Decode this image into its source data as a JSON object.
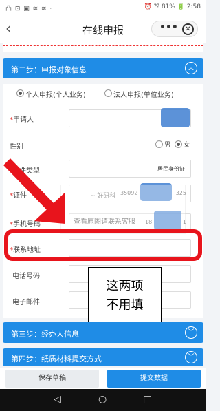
{
  "status": {
    "left": "凸 ⊡ ▣ ≋ ≋ ·",
    "right": "⏰ ⁇ 81% 🔋 2:58"
  },
  "nav": {
    "back": "‹",
    "title": "在线申报",
    "more": "•••",
    "close": "✕"
  },
  "section2": {
    "title": "第二步：申报对象信息",
    "chevron": "︿"
  },
  "form": {
    "applicant_type_personal": "个人申报(个人业务)",
    "applicant_type_legal": "法人申报(单位业务)",
    "applicant_label": "申请人",
    "gender_label": "性别",
    "gender_male": "男",
    "gender_female": "女",
    "cert_type_label": "件类型",
    "cert_type_value": "居民身份证",
    "cert_no_label": "证件",
    "cert_no_part1": "35092",
    "cert_no_part2": "325",
    "phone_label": "手机号码",
    "phone_part": "18",
    "phone_part2": "1",
    "address_label": "联系地址",
    "tel_label": "电话号码",
    "email_label": "电子邮件"
  },
  "watermark": {
    "logo": "~ 好研科",
    "text": "查看原图请联系客服"
  },
  "callout": {
    "line1": "这两项",
    "line2": "不用填"
  },
  "section3": {
    "title": "第三步：经办人信息",
    "chevron": "﹀"
  },
  "section4": {
    "title": "第四步：纸质材料提交方式",
    "chevron": "﹀"
  },
  "buttons": {
    "save": "保存草稿",
    "submit": "提交数据"
  },
  "sysnav": {
    "back": "◁",
    "home": "○",
    "recent": "□"
  },
  "colors": {
    "primary": "#1f8ce6",
    "annotation": "#e8141c"
  }
}
